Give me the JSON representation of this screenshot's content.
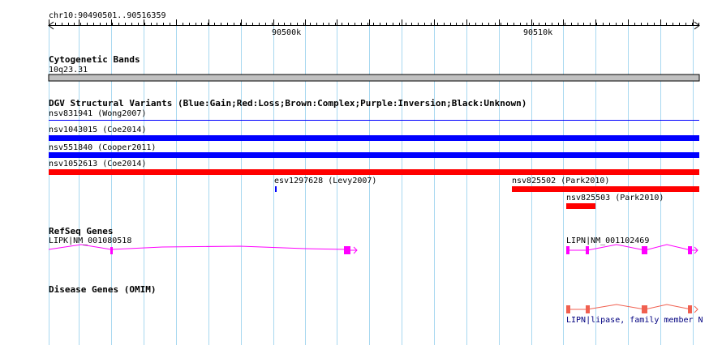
{
  "ruler": {
    "position_label": "chr10:90490501..90516359",
    "tick_labels": [
      "90500k",
      "90510k"
    ]
  },
  "tracks": {
    "cytogenetic": {
      "title": "Cytogenetic Bands",
      "band_label": "10q23.31",
      "band_color": "#c0c0c0"
    },
    "dgv": {
      "title": "DGV Structural Variants (Blue:Gain;Red:Loss;Brown:Complex;Purple:Inversion;Black:Unknown)",
      "variants": [
        {
          "label": "nsv831941  (Wong2007)",
          "type": "Gain"
        },
        {
          "label": "nsv1043015  (Coe2014)",
          "type": "Gain"
        },
        {
          "label": "nsv551840  (Cooper2011)",
          "type": "Gain"
        },
        {
          "label": "nsv1052613  (Coe2014)",
          "type": "Loss"
        },
        {
          "label": "esv1297628  (Levy2007)",
          "type": "Gain"
        },
        {
          "label": "nsv825502  (Park2010)",
          "type": "Loss"
        },
        {
          "label": "nsv825503  (Park2010)",
          "type": "Loss"
        }
      ],
      "colors": {
        "Gain": "#0000ff",
        "Loss": "#ff0000"
      }
    },
    "refseq": {
      "title": "RefSeq Genes",
      "genes": [
        {
          "label": "LIPK|NM_001080518"
        },
        {
          "label": "LIPN|NM_001102469"
        }
      ],
      "color": "#ff00ff"
    },
    "omim": {
      "title": "Disease Genes (OMIM)",
      "genes": [
        {
          "label": "LIPN|lipase, family member N"
        }
      ],
      "color": "#f06050"
    }
  }
}
